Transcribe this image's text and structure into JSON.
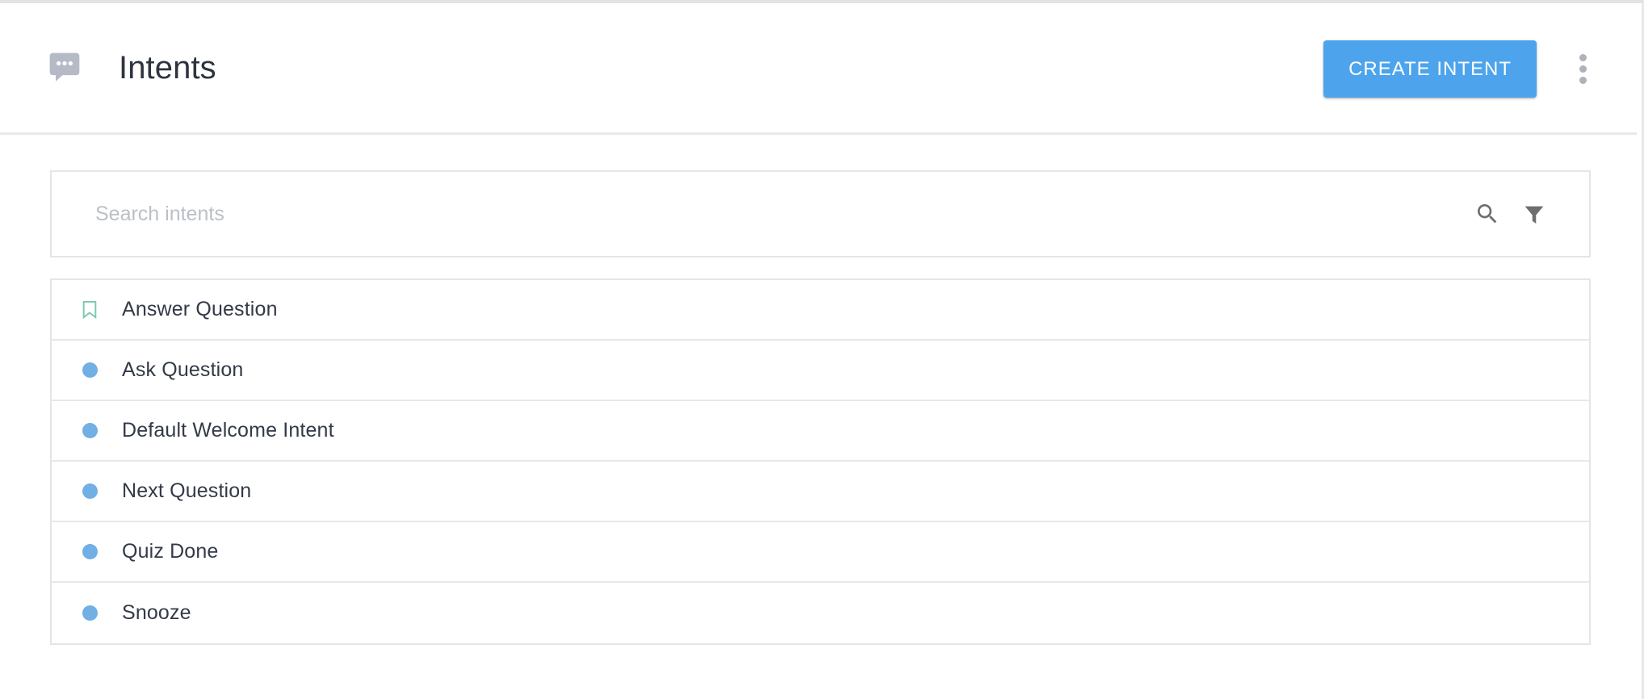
{
  "header": {
    "icon": "chat-bubble-icon",
    "title": "Intents",
    "create_button_label": "CREATE INTENT",
    "overflow_menu": "more-vert-icon",
    "accent_color": "#4da4ec",
    "title_color": "#2d3440",
    "icon_color": "#b6bac6"
  },
  "search": {
    "placeholder": "Search intents",
    "value": "",
    "search_icon": "search-icon",
    "filter_icon": "filter-icon",
    "icon_color": "#6e6e6e"
  },
  "intents": {
    "marker_dot_color": "#71afe4",
    "marker_bookmark_color": "#7cc9ad",
    "rows": [
      {
        "label": "Answer Question",
        "marker": "bookmark"
      },
      {
        "label": "Ask Question",
        "marker": "dot"
      },
      {
        "label": "Default Welcome Intent",
        "marker": "dot"
      },
      {
        "label": "Next Question",
        "marker": "dot"
      },
      {
        "label": "Quiz Done",
        "marker": "dot"
      },
      {
        "label": "Snooze",
        "marker": "dot"
      }
    ]
  }
}
